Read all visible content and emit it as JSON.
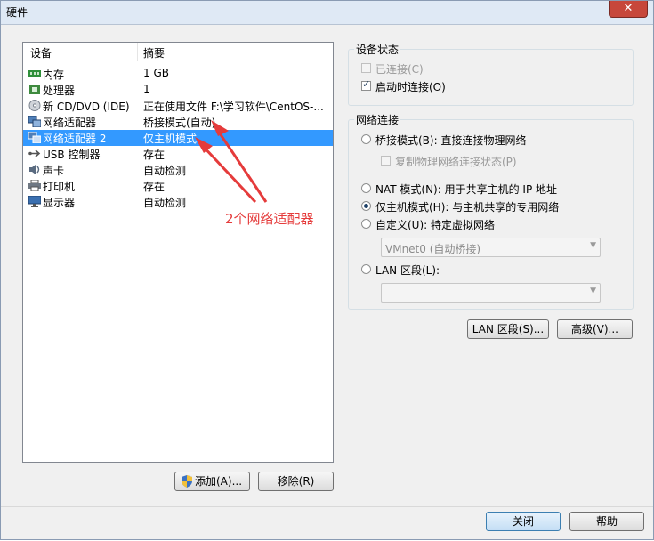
{
  "window": {
    "title": "硬件",
    "close_glyph": "✕"
  },
  "device_list": {
    "headers": {
      "device": "设备",
      "summary": "摘要"
    },
    "rows": [
      {
        "icon": "memory-icon",
        "device": "内存",
        "summary": "1 GB"
      },
      {
        "icon": "processor-icon",
        "device": "处理器",
        "summary": "1"
      },
      {
        "icon": "cd-dvd-icon",
        "device": "新 CD/DVD (IDE)",
        "summary": "正在使用文件 F:\\学习软件\\CentOS-..."
      },
      {
        "icon": "network-adapter-icon",
        "device": "网络适配器",
        "summary": "桥接模式(自动)"
      },
      {
        "icon": "network-adapter-icon",
        "device": "网络适配器 2",
        "summary": "仅主机模式",
        "selected": true
      },
      {
        "icon": "usb-icon",
        "device": "USB 控制器",
        "summary": "存在"
      },
      {
        "icon": "sound-card-icon",
        "device": "声卡",
        "summary": "自动检测"
      },
      {
        "icon": "printer-icon",
        "device": "打印机",
        "summary": "存在"
      },
      {
        "icon": "display-icon",
        "device": "显示器",
        "summary": "自动检测"
      }
    ],
    "add_button": "添加(A)...",
    "remove_button": "移除(R)"
  },
  "device_status": {
    "title": "设备状态",
    "connected": {
      "label": "已连接(C)",
      "checked": false,
      "disabled": true
    },
    "connect_on_power": {
      "label": "启动时连接(O)",
      "checked": true
    }
  },
  "network_connection": {
    "title": "网络连接",
    "bridged": {
      "label": "桥接模式(B): 直接连接物理网络",
      "selected": false
    },
    "replicate": {
      "label": "复制物理网络连接状态(P)",
      "checked": false,
      "disabled": true
    },
    "nat": {
      "label": "NAT 模式(N): 用于共享主机的 IP 地址",
      "selected": false
    },
    "host_only": {
      "label": "仅主机模式(H): 与主机共享的专用网络",
      "selected": true
    },
    "custom": {
      "label": "自定义(U): 特定虚拟网络",
      "selected": false
    },
    "custom_select": "VMnet0 (自动桥接)",
    "lan_segment": {
      "label": "LAN 区段(L):",
      "selected": false
    },
    "lan_select": ""
  },
  "buttons": {
    "lan_segments": "LAN 区段(S)...",
    "advanced": "高级(V)...",
    "close": "关闭",
    "help": "帮助"
  },
  "annotation": {
    "text": "2个网络适配器",
    "color": "#e53b3b"
  },
  "colors": {
    "selection": "#3399ff",
    "annotation": "#e53b3b"
  }
}
